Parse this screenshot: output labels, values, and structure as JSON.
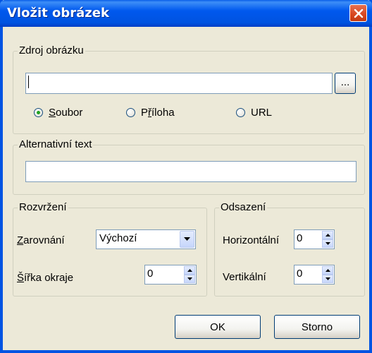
{
  "window": {
    "title": "Vložit obrázek"
  },
  "source_group": {
    "label": "Zdroj obrázku",
    "path_value": "",
    "browse_label": "...",
    "radios": [
      {
        "prefix": "",
        "accel": "S",
        "suffix": "oubor",
        "checked": true
      },
      {
        "prefix": "P",
        "accel": "ř",
        "suffix": "íloha",
        "checked": false
      },
      {
        "prefix": "",
        "accel": "",
        "suffix": "URL",
        "checked": false
      }
    ]
  },
  "alt_group": {
    "label": "Alternativní text",
    "value": ""
  },
  "layout_group": {
    "label": "Rozvržení",
    "align": {
      "accel": "Z",
      "rest": "arovnání",
      "value": "Výchozí"
    },
    "border": {
      "accel": "Š",
      "rest": "ířka okraje",
      "value": "0"
    }
  },
  "spacing_group": {
    "label": "Odsazení",
    "horizontal": {
      "label": "Horizontální",
      "value": "0"
    },
    "vertical": {
      "label": "Vertikální",
      "value": "0"
    }
  },
  "buttons": {
    "ok": "OK",
    "cancel": "Storno"
  }
}
